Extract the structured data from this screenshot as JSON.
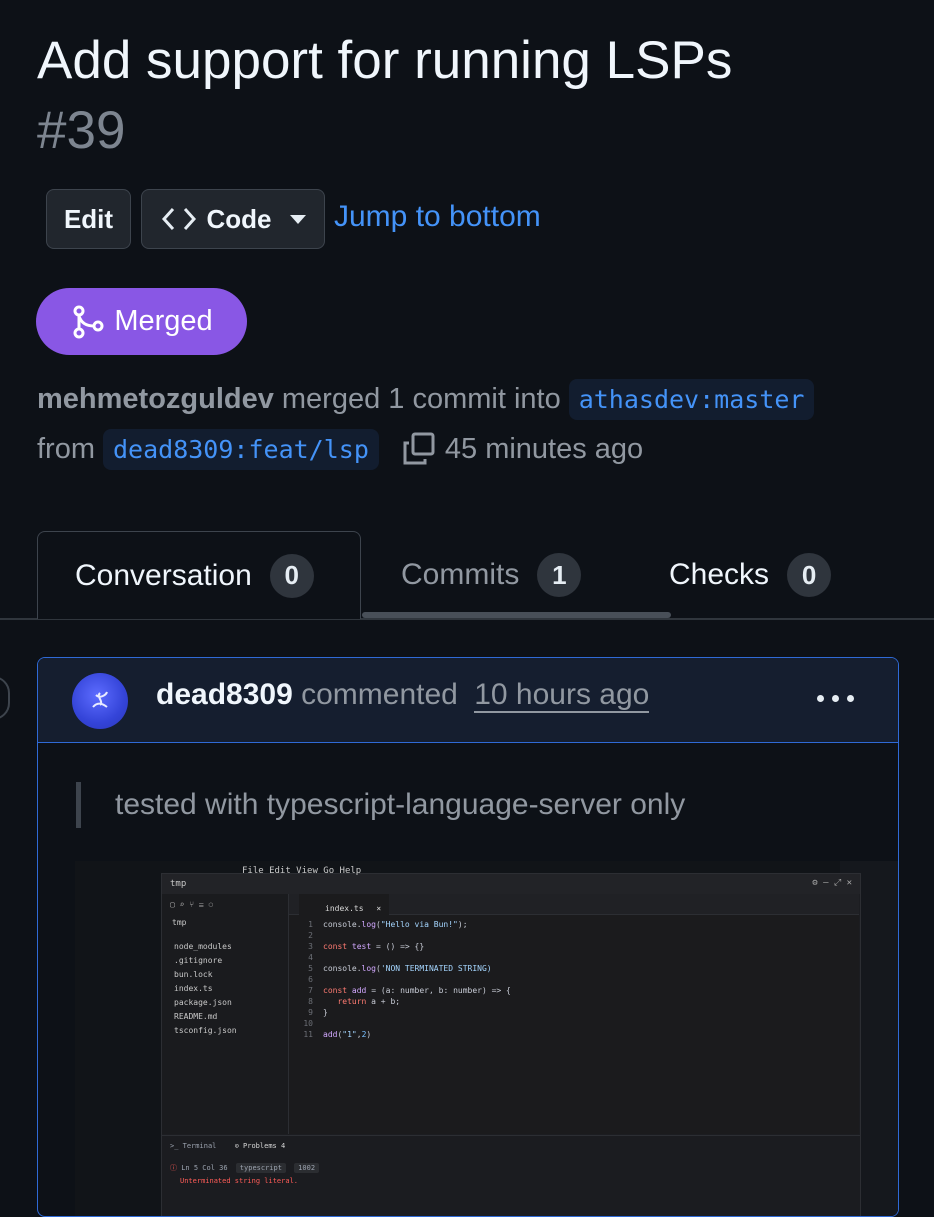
{
  "header": {
    "title": "Add support for running LSPs",
    "number": "#39"
  },
  "actions": {
    "edit_label": "Edit",
    "code_label": "Code",
    "jump_label": "Jump to bottom"
  },
  "status": {
    "label": "Merged",
    "color": "#8957e5"
  },
  "meta": {
    "author": "mehmetozguldev",
    "merged_text": "merged 1 commit into",
    "base_branch": "athasdev:master",
    "from_text": "from",
    "head_branch": "dead8309:feat/lsp",
    "time": "45 minutes ago"
  },
  "tabs": [
    {
      "label": "Conversation",
      "count": "0"
    },
    {
      "label": "Commits",
      "count": "1"
    },
    {
      "label": "Checks",
      "count": "0"
    }
  ],
  "comment": {
    "author": "dead8309",
    "verb": "commented",
    "time": "10 hours ago",
    "quote": "tested with typescript-language-server only"
  },
  "screenshot": {
    "menu": "File  Edit  View  Go  Help",
    "project": "tmp",
    "tab_file": "index.ts",
    "files": [
      "node_modules",
      ".gitignore",
      "bun.lock",
      "index.ts",
      "package.json",
      "README.md",
      "tsconfig.json"
    ],
    "panel_terminal": "Terminal",
    "panel_problems": "Problems",
    "problems_count": "4",
    "problem_loc": "Ln 5 Col 36",
    "problem_lang": "typescript",
    "problem_code": "1002",
    "problem_msg": "Unterminated string literal."
  },
  "colors": {
    "background": "#0d1117",
    "link": "#4493f8",
    "comment_border": "#2f6ad6"
  }
}
